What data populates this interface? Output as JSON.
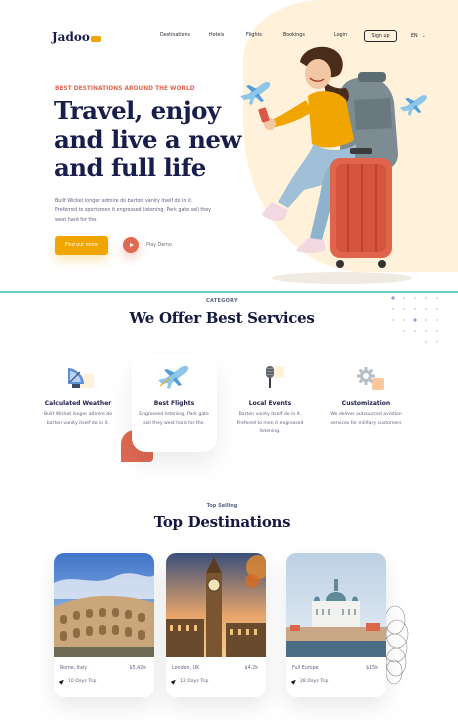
{
  "header": {
    "logo": "Jadoo",
    "nav": [
      "Destinations",
      "Hotels",
      "Flights",
      "Bookings"
    ],
    "login": "Login",
    "signup": "Sign up",
    "lang": "EN"
  },
  "hero": {
    "kicker": "BEST DESTINATIONS AROUND THE WORLD",
    "title_lines": [
      "Travel, enjoy",
      "and live a new",
      "and full life"
    ],
    "description": "Built Wicket longer admire do barton vanity itself do in it. Preferred to sportsmen it engrossed listening. Park gate sell they west hard for the.",
    "cta": "Find out more",
    "play": "Play Demo"
  },
  "services": {
    "category": "CATEGORY",
    "title": "We Offer Best Services",
    "items": [
      {
        "title": "Calculated Weather",
        "desc": "Built Wicket longer admire do barton vanity itself do in it.",
        "icon": "satellite-dish-icon"
      },
      {
        "title": "Best Flights",
        "desc": "Engrossed listening. Park gate sell they west hard for the.",
        "icon": "airplane-icon"
      },
      {
        "title": "Local Events",
        "desc": "Barton vanity itself do in it. Prefered to men it engrossed listening.",
        "icon": "microphone-icon"
      },
      {
        "title": "Customization",
        "desc": "We deliver outsourced aviation services for military customers",
        "icon": "gear-icon"
      }
    ]
  },
  "destinations": {
    "label": "Top Selling",
    "title": "Top Destinations",
    "items": [
      {
        "name": "Rome, Italy",
        "price": "$5,42k",
        "trip": "10 Days Trip"
      },
      {
        "name": "London, UK",
        "price": "$4.2k",
        "trip": "12 Days Trip"
      },
      {
        "name": "Full Europe",
        "price": "$15k",
        "trip": "28 Days Trip"
      }
    ]
  },
  "colors": {
    "accent": "#f1a501",
    "coral": "#df6951",
    "navy": "#181e4b",
    "teal": "#5fd3c4",
    "cream": "#fff1da"
  }
}
